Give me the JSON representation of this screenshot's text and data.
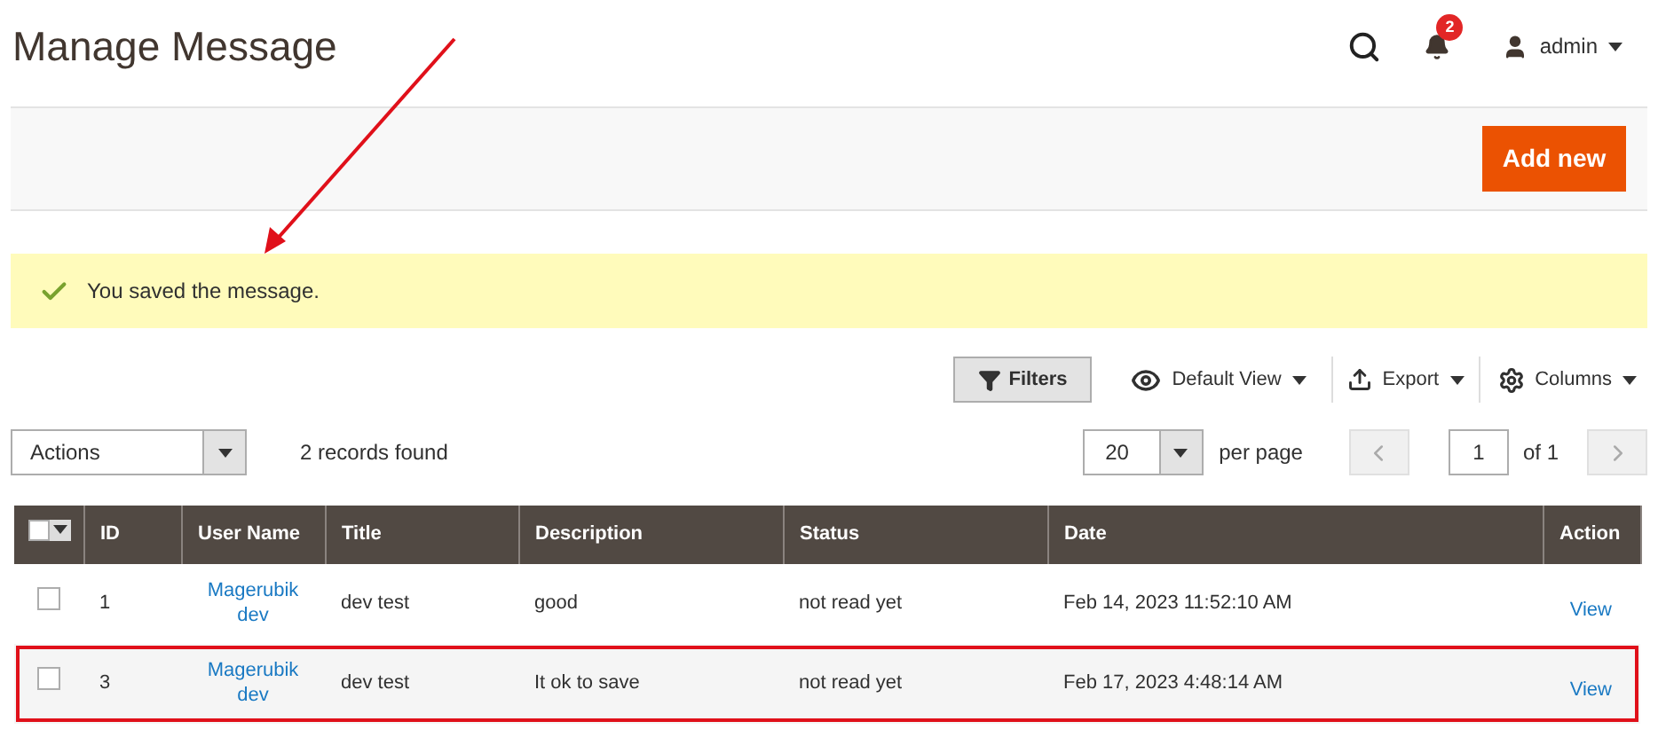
{
  "page_title": "Manage Message",
  "header": {
    "notifications": "2",
    "user": "admin"
  },
  "add_button": "Add new",
  "message": "You saved the message.",
  "toolbar": {
    "filters": "Filters",
    "view": "Default View",
    "export": "Export",
    "columns": "Columns"
  },
  "actions": {
    "value": "Actions",
    "records": "2 records found",
    "per_page_value": "20",
    "per_page": "per page",
    "page": "1",
    "of": "of 1"
  },
  "table": {
    "select_all": {
      "checked": false
    },
    "columns": [
      "ID",
      "User Name",
      "Title",
      "Description",
      "Status",
      "Date",
      "Action"
    ],
    "rows": [
      {
        "checked": false,
        "highlighted": false,
        "cells": [
          "1",
          "Magerubik dev",
          "dev test",
          "good",
          "not read yet",
          "Feb 14, 2023 11:52:10 AM"
        ],
        "action": "View"
      },
      {
        "checked": false,
        "highlighted": true,
        "cells": [
          "3",
          "Magerubik dev",
          "dev test",
          "It ok to save",
          "not read yet",
          "Feb 17, 2023 4:48:14 AM"
        ],
        "action": "View"
      }
    ]
  }
}
